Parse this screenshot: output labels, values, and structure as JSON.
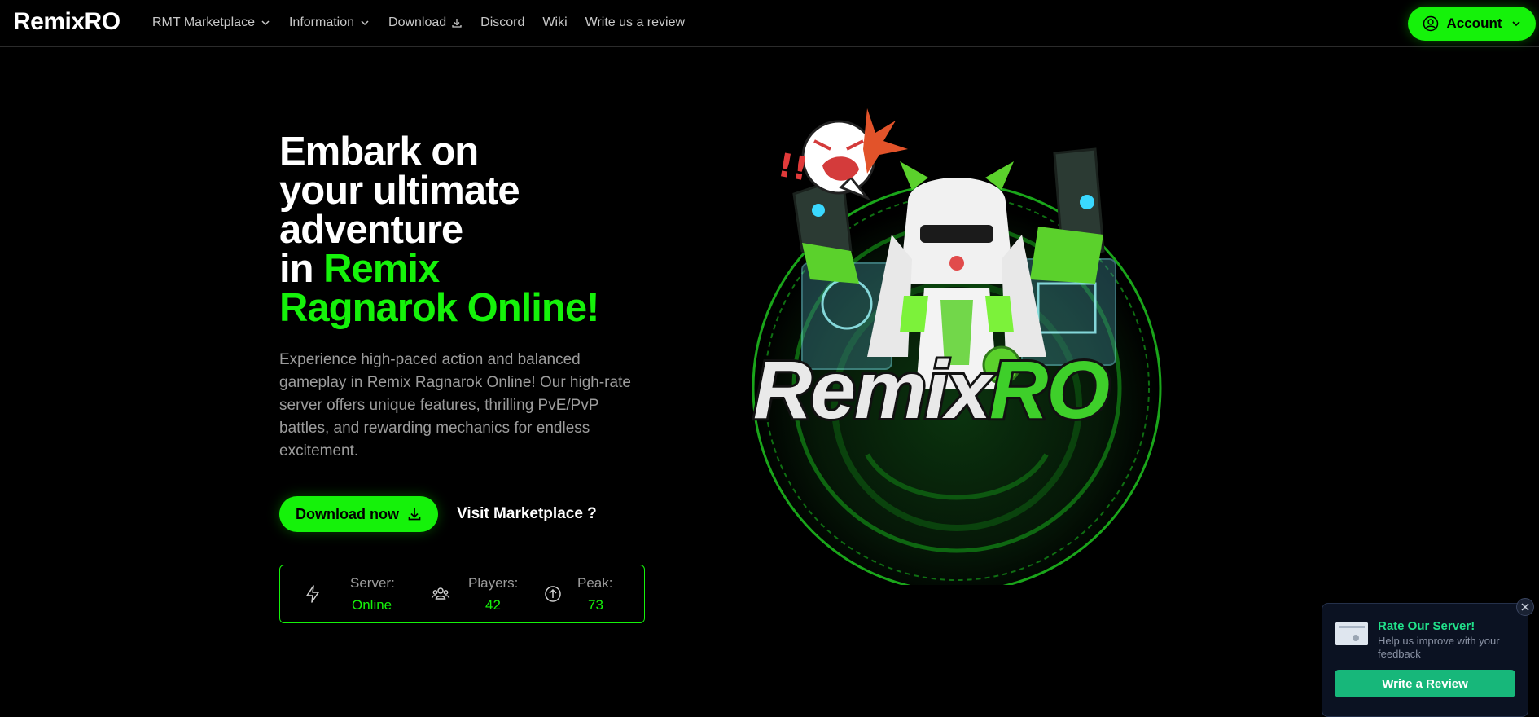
{
  "nav": {
    "logo": "RemixRO",
    "links": [
      {
        "label": "RMT Marketplace",
        "icon": "chevron-down-icon"
      },
      {
        "label": "Information",
        "icon": "chevron-down-icon"
      },
      {
        "label": "Download",
        "icon": "download-icon"
      },
      {
        "label": "Discord"
      },
      {
        "label": "Wiki"
      },
      {
        "label": "Write us a review"
      }
    ],
    "account_label": "Account"
  },
  "hero": {
    "title_line1": "Embark on",
    "title_line2": "your ultimate",
    "title_line3": "adventure",
    "title_line4_prefix": "in ",
    "title_line4_highlight": "Remix",
    "title_line5_highlight": "Ragnarok Online!",
    "description": "Experience high-paced action and balanced gameplay in Remix Ragnarok Online! Our high-rate server offers unique features, thrilling PvE/PvP battles, and rewarding mechanics for endless excitement.",
    "download_label": "Download now",
    "marketplace_label": "Visit Marketplace ?"
  },
  "stats": {
    "server_label": "Server:",
    "server_value": "Online",
    "players_label": "Players:",
    "players_value": "42",
    "peak_label": "Peak:",
    "peak_value": "73"
  },
  "art": {
    "logo_text_white": "Remix",
    "logo_text_green": "RO"
  },
  "review": {
    "title": "Rate Our Server!",
    "subtitle": "Help us improve with your feedback",
    "button_label": "Write a Review"
  },
  "colors": {
    "accent": "#15f20a",
    "background": "#000000",
    "review_accent": "#17b77a"
  }
}
